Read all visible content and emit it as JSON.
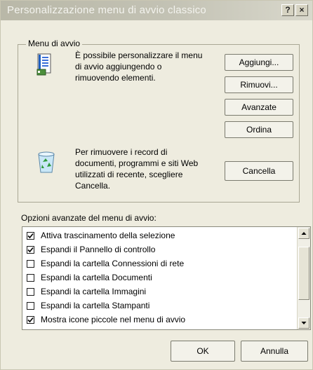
{
  "window": {
    "title": "Personalizzazione menu di avvio classico",
    "help_label": "?",
    "close_label": "×"
  },
  "startmenu_group": {
    "label": "Menu di avvio",
    "description": [
      "È possibile personalizzare il menu",
      "di avvio aggiungendo o",
      "rimuovendo elementi."
    ],
    "buttons": {
      "add": "Aggiungi...",
      "remove": "Rimuovi...",
      "advanced": "Avanzate",
      "sort": "Ordina"
    },
    "clear_description": [
      "Per rimuovere i record di",
      "documenti, programmi e siti Web",
      "utilizzati di recente, scegliere",
      "Cancella."
    ],
    "clear_button": "Cancella",
    "icons": {
      "menu": "start-menu-icon",
      "recycle": "recycle-bin-icon"
    }
  },
  "advanced_options": {
    "label": "Opzioni avanzate del menu di avvio:",
    "items": [
      {
        "label": "Attiva trascinamento della selezione",
        "checked": true
      },
      {
        "label": "Espandi il Pannello di controllo",
        "checked": true
      },
      {
        "label": "Espandi la cartella Connessioni di rete",
        "checked": false
      },
      {
        "label": "Espandi la cartella Documenti",
        "checked": false
      },
      {
        "label": "Espandi la cartella Immagini",
        "checked": false
      },
      {
        "label": "Espandi la cartella Stampanti",
        "checked": false
      },
      {
        "label": "Mostra icone piccole nel menu di avvio",
        "checked": true
      }
    ]
  },
  "footer": {
    "ok": "OK",
    "cancel": "Annulla"
  }
}
